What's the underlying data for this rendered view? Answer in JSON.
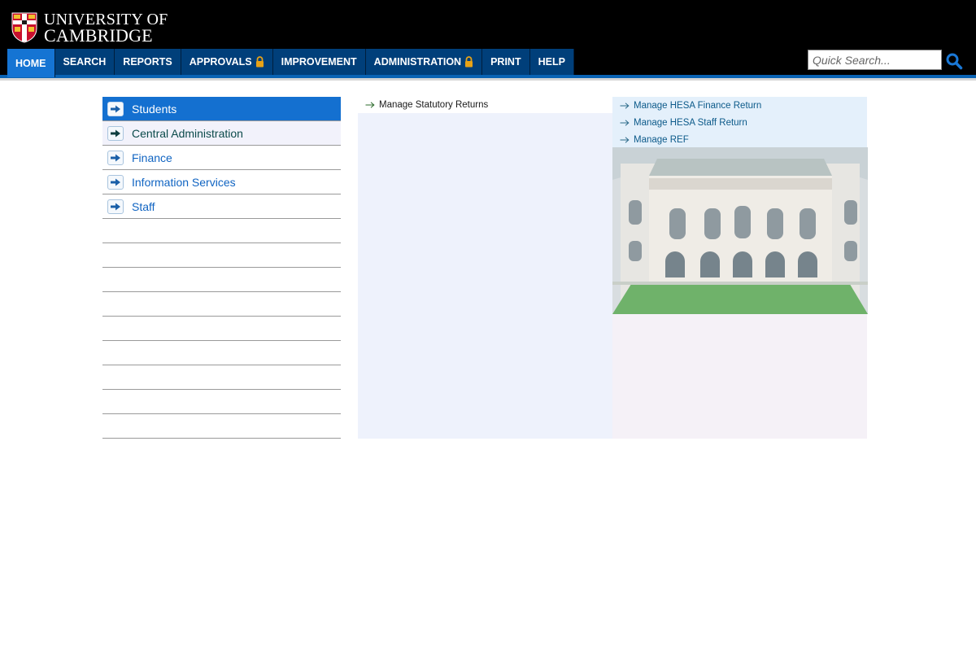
{
  "logo": {
    "line1": "UNIVERSITY OF",
    "line2": "CAMBRIDGE"
  },
  "nav": [
    {
      "label": "HOME",
      "active": true,
      "locked": false
    },
    {
      "label": "SEARCH",
      "active": false,
      "locked": false
    },
    {
      "label": "REPORTS",
      "active": false,
      "locked": false
    },
    {
      "label": "APPROVALS",
      "active": false,
      "locked": true
    },
    {
      "label": "IMPROVEMENT",
      "active": false,
      "locked": false
    },
    {
      "label": "ADMINISTRATION",
      "active": false,
      "locked": true
    },
    {
      "label": "PRINT",
      "active": false,
      "locked": false
    },
    {
      "label": "HELP",
      "active": false,
      "locked": false
    }
  ],
  "search": {
    "placeholder": "Quick Search..."
  },
  "left_menu": {
    "items": [
      {
        "label": "Students"
      },
      {
        "label": "Central Administration"
      },
      {
        "label": "Finance"
      },
      {
        "label": "Information Services"
      },
      {
        "label": "Staff"
      }
    ]
  },
  "center_links": [
    {
      "label": "Manage Statutory Returns"
    }
  ],
  "right_links": [
    {
      "label": "Manage HESA Finance Return"
    },
    {
      "label": "Manage HESA Staff Return"
    },
    {
      "label": "Manage REF"
    }
  ],
  "colors": {
    "nav_bg": "#003f7a",
    "nav_active": "#1574d3",
    "accent_blue": "#0a63b4",
    "menu_selected": "#1470d0",
    "lock": "#e8a317"
  }
}
